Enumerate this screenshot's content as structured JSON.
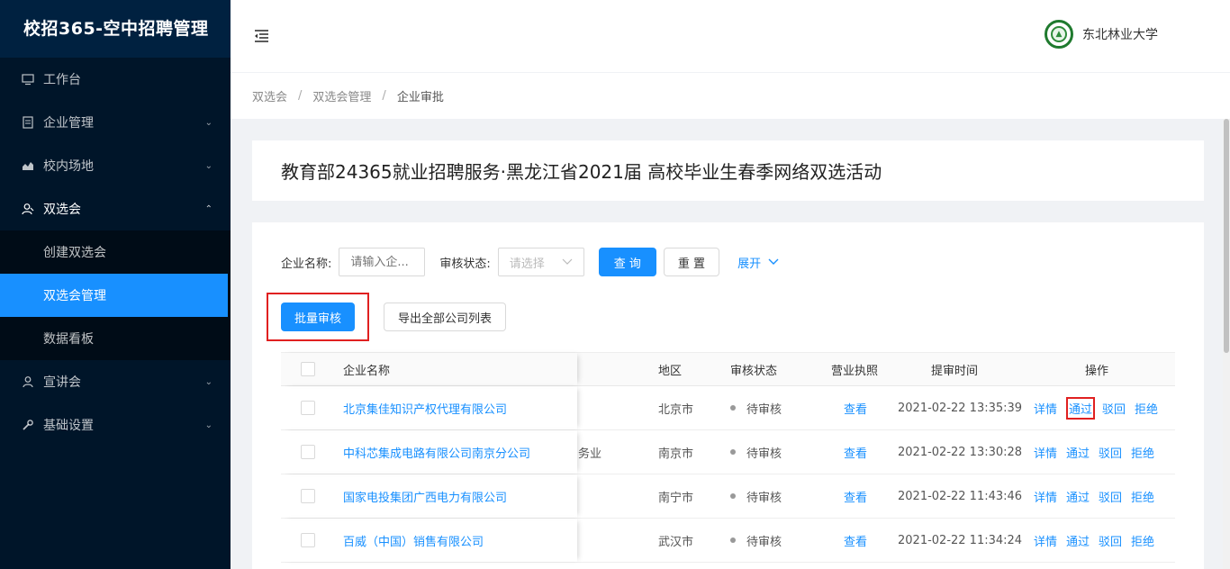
{
  "sidebar": {
    "brand": "校招365-空中招聘管理",
    "items": [
      {
        "label": "工作台",
        "icon": "monitor-icon"
      },
      {
        "label": "企业管理",
        "icon": "form-icon"
      },
      {
        "label": "校内场地",
        "icon": "area-chart-icon"
      },
      {
        "label": "双选会",
        "icon": "team-icon"
      },
      {
        "label": "宣讲会",
        "icon": "user-icon"
      },
      {
        "label": "基础设置",
        "icon": "tool-icon"
      }
    ],
    "submenu": [
      "创建双选会",
      "双选会管理",
      "数据看板"
    ]
  },
  "header": {
    "school_name": "东北林业大学"
  },
  "breadcrumb": [
    "双选会",
    "双选会管理",
    "企业审批"
  ],
  "title": "教育部24365就业招聘服务·黑龙江省2021届 高校毕业生春季网络双选活动",
  "filter": {
    "company_label": "企业名称:",
    "company_placeholder": "请输入企...",
    "status_label": "审核状态:",
    "status_placeholder": "请选择",
    "query_label": "查 询",
    "reset_label": "重 置",
    "expand_label": "展开"
  },
  "actions": {
    "batch_label": "批量审核",
    "export_label": "导出全部公司列表"
  },
  "table": {
    "columns": {
      "name": "企业名称",
      "region": "地区",
      "status": "审核状态",
      "license": "营业执照",
      "time": "提审时间",
      "ops": "操作"
    },
    "rows": [
      {
        "name": "北京集佳知识产权代理有限公司",
        "industry": "",
        "region": "北京市",
        "status": "待审核",
        "license": "查看",
        "time": "2021-02-22 13:35:39"
      },
      {
        "name": "中科芯集成电路有限公司南京分公司",
        "industry": "务业",
        "region": "南京市",
        "status": "待审核",
        "license": "查看",
        "time": "2021-02-22 13:30:28"
      },
      {
        "name": "国家电投集团广西电力有限公司",
        "industry": "",
        "region": "南宁市",
        "status": "待审核",
        "license": "查看",
        "time": "2021-02-22 11:43:46"
      },
      {
        "name": "百威（中国）销售有限公司",
        "industry": "",
        "region": "武汉市",
        "status": "待审核",
        "license": "查看",
        "time": "2021-02-22 11:34:24"
      }
    ],
    "op_labels": {
      "detail": "详情",
      "pass": "通过",
      "reject_back": "驳回",
      "refuse": "拒绝"
    }
  }
}
